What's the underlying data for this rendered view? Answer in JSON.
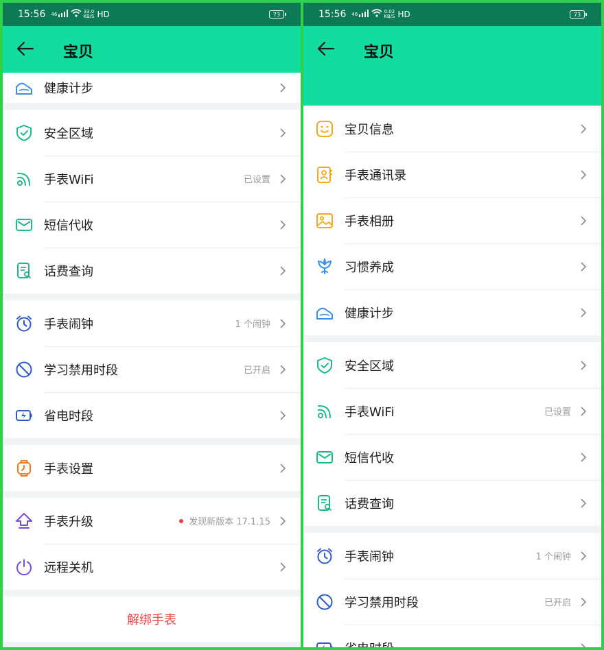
{
  "colors": {
    "frame": "#2fd04a",
    "statusbar": "#0c7a55",
    "header": "#12dd9f",
    "danger": "#f04848"
  },
  "left": {
    "status": {
      "time": "15:56",
      "net_top": "46",
      "speed_top": "33.0",
      "speed_bottom": "KB/S",
      "hd": "HD",
      "battery": "73"
    },
    "header": {
      "title": "宝贝"
    },
    "groups": [
      [
        {
          "icon": "health-steps-icon",
          "label": "健康计步"
        }
      ],
      [
        {
          "icon": "safe-zone-icon",
          "label": "安全区域"
        },
        {
          "icon": "wifi-icon",
          "label": "手表WiFi",
          "value": "已设置"
        },
        {
          "icon": "sms-icon",
          "label": "短信代收"
        },
        {
          "icon": "bill-query-icon",
          "label": "话费查询"
        }
      ],
      [
        {
          "icon": "alarm-icon",
          "label": "手表闹钟",
          "value": "1 个闹钟"
        },
        {
          "icon": "forbidden-icon",
          "label": "学习禁用时段",
          "value": "已开启"
        },
        {
          "icon": "battery-save-icon",
          "label": "省电时段"
        }
      ],
      [
        {
          "icon": "watch-settings-icon",
          "label": "手表设置"
        }
      ],
      [
        {
          "icon": "upgrade-icon",
          "label": "手表升级",
          "value": "发现新版本 17.1.15"
        },
        {
          "icon": "power-icon",
          "label": "远程关机"
        }
      ]
    ],
    "unbind": "解绑手表"
  },
  "right": {
    "status": {
      "time": "15:56",
      "net_top": "46",
      "speed_top": "0.02",
      "speed_bottom": "KB/S",
      "hd": "HD",
      "battery": "73"
    },
    "header": {
      "title": "宝贝"
    },
    "groups": [
      [
        {
          "icon": "smile-icon",
          "label": "宝贝信息"
        },
        {
          "icon": "contacts-icon",
          "label": "手表通讯录"
        },
        {
          "icon": "album-icon",
          "label": "手表相册"
        },
        {
          "icon": "habit-icon",
          "label": "习惯养成"
        },
        {
          "icon": "health-steps-icon",
          "label": "健康计步"
        }
      ],
      [
        {
          "icon": "safe-zone-icon",
          "label": "安全区域"
        },
        {
          "icon": "wifi-icon",
          "label": "手表WiFi",
          "value": "已设置"
        },
        {
          "icon": "sms-icon",
          "label": "短信代收"
        },
        {
          "icon": "bill-query-icon",
          "label": "话费查询"
        }
      ],
      [
        {
          "icon": "alarm-icon",
          "label": "手表闹钟",
          "value": "1 个闹钟"
        },
        {
          "icon": "forbidden-icon",
          "label": "学习禁用时段",
          "value": "已开启"
        },
        {
          "icon": "battery-save-icon",
          "label": "省电时段"
        }
      ]
    ]
  }
}
